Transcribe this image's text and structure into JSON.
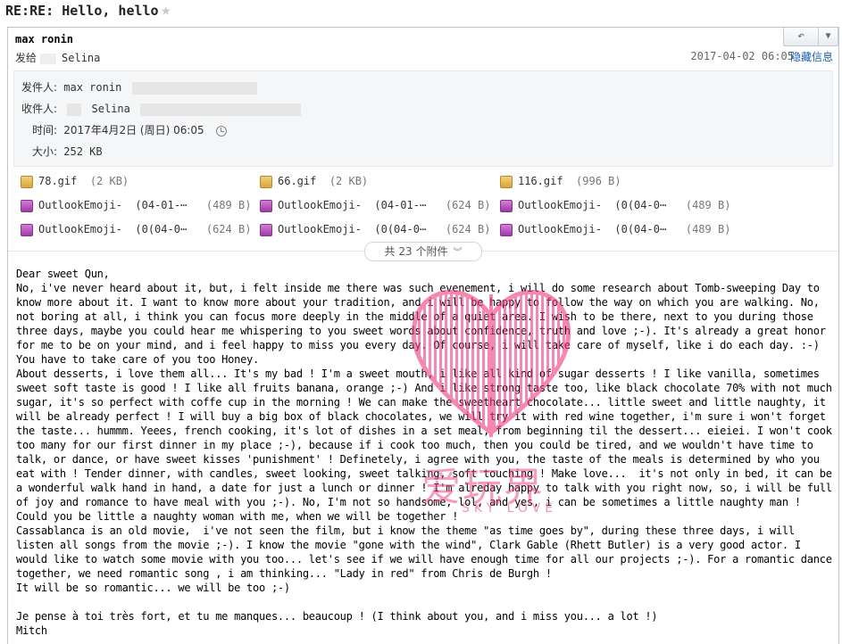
{
  "email": {
    "subject": "RE:RE: Hello, hello",
    "sender_name": "max ronin",
    "send_to_label": "发给",
    "recipient": "Selina",
    "date": "2017-04-02 06:05",
    "hide_info_label": "隐藏信息",
    "details": {
      "from_label": "发件人:",
      "from_value": "max ronin",
      "to_label": "收件人:",
      "to_value": "Selina",
      "time_label": "时间:",
      "time_value": "2017年4月2日 (周日) 06:05",
      "size_label": "大小:",
      "size_value": "252 KB"
    },
    "attachments": [
      {
        "name": "78.gif",
        "size": "(2 KB)",
        "type": "gif"
      },
      {
        "name": "66.gif",
        "size": "(2 KB)",
        "type": "gif"
      },
      {
        "name": "116.gif",
        "size": "(996 B)",
        "type": "gif"
      },
      {
        "name": "OutlookEmoji-",
        "extra": "(04-01-⋯",
        "size": "(489 B)",
        "type": "png"
      },
      {
        "name": "OutlookEmoji-",
        "extra": "(04-01-⋯",
        "size": "(624 B)",
        "type": "png"
      },
      {
        "name": "OutlookEmoji-",
        "extra": "(0(04-0⋯",
        "size": "(489 B)",
        "type": "png"
      },
      {
        "name": "OutlookEmoji-",
        "extra": "(0(04-0⋯",
        "size": "(624 B)",
        "type": "png"
      },
      {
        "name": "OutlookEmoji-",
        "extra": "(0(04-0⋯",
        "size": "(624 B)",
        "type": "png"
      },
      {
        "name": "OutlookEmoji-",
        "extra": "(0(04-0⋯",
        "size": "(489 B)",
        "type": "png"
      }
    ],
    "attachments_more_label": "共 23 个附件",
    "body": "Dear sweet Qun,\nNo, i've never heard about it, but, i felt inside me there was such evenement, i will do some research about Tomb-sweeping Day to know more about it. I want to know more about your tradition, and i will be happy to follow the way on which you are walking. No, not boring at all, i think you can focus more deeply in the middle of a quiet area. I wish to be there, next to you during those three days, maybe you could hear me whispering to you sweet words about confidence, truth and love ;-). It's already a great honor for me to be on your mind, and i feel happy to miss you every day. Of course, i will take care of myself, like i do each day. :-) You have to take care of you too Honey.\nAbout desserts, i love them all... It's my bad ! I'm a sweet mouth, i like all kind of sugar desserts ! I like vanilla, sometimes sweet soft taste is good ! I like all fruits banana, orange ;-) And i like strong taste too, like black chocolate 70% with not much sugar, it's so perfect with coffe cup in the morning ! We can make the sweetheart chocolate... little sweet and little naughty, it will be already perfect ! I will buy a big box of black chocolates, we will try it with red wine together, i'm sure i won't forget the taste... hummm. Yeees, french cooking, it's lot of dishes in a set meal, from beginning til the dessert... eieiei. I won't cook too many for our first dinner in my place ;-), because if i cook too much, then you could be tired, and we wouldn't have time to talk, or dance, or have sweet kisses 'punishment' ! Definetely, i agree with you, the taste of the meals is determined by who you eat with ! Tender dinner, with candles, sweet looking, sweet talking, soft touching ! Make love...  it's not only in bed, it can be a wonderful walk hand in hand, a date for just a lunch or dinner ! I'm alreday happy to talk with you right now, so, i will be full of joy and romance to have meal with you ;-). No, I'm not so handsome, lol, and yes, i can be sometimes a little naughty man ! Could you be little a naughty woman with me, when we will be together !\nCassablanca is an old movie,  i've not seen the film, but i know the theme \"as time goes by\", during these three days, i will listen all songs from the movie ;-). I know the movie \"gone with the wind\", Clark Gable (Rhett Butler) is a very good actor. I would like to watch some movie with you too... let's see if we will have enough time for all our projects ;-). For a romantic dance together, we need romantic song , i am thinking... \"Lady in red\" from Chris de Burgh !\nIt will be so romantic... we will be too ;-)\n\nJe pense à toi très fort, et tu me manques... beaucoup ! (I think about you, and i miss you... a lot !)\nMitch"
  },
  "watermark": {
    "text": "爱玩界",
    "sub": "SKY LOVE"
  },
  "colors": {
    "link": "#1c5da8",
    "border": "#b7c7d6",
    "watermark": "#f04b8a"
  }
}
